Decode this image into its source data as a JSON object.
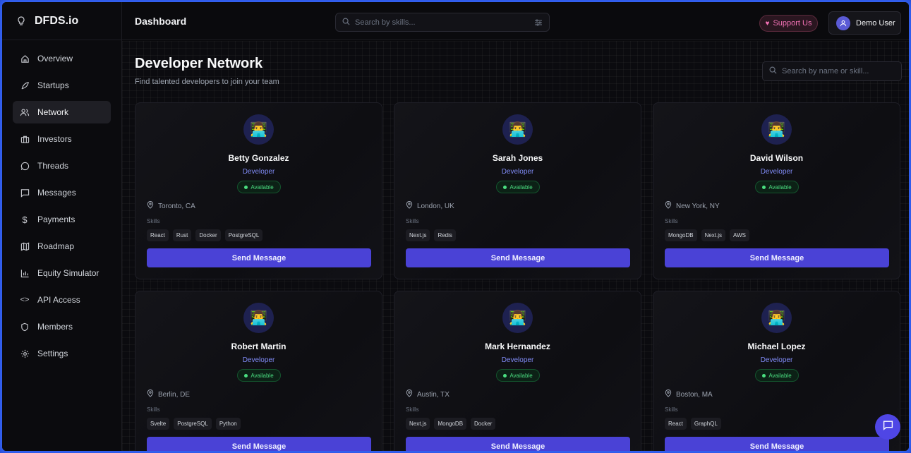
{
  "brand": {
    "name": "DFDS.io"
  },
  "sidebar": {
    "items": [
      {
        "label": "Overview",
        "icon": "home-icon"
      },
      {
        "label": "Startups",
        "icon": "rocket-icon"
      },
      {
        "label": "Network",
        "icon": "users-icon",
        "active": true
      },
      {
        "label": "Investors",
        "icon": "briefcase-icon"
      },
      {
        "label": "Threads",
        "icon": "chat-bubble-icon"
      },
      {
        "label": "Messages",
        "icon": "message-square-icon"
      },
      {
        "label": "Payments",
        "icon": "dollar-icon"
      },
      {
        "label": "Roadmap",
        "icon": "map-icon"
      },
      {
        "label": "Equity Simulator",
        "icon": "bar-chart-icon"
      },
      {
        "label": "API Access",
        "icon": "code-icon"
      },
      {
        "label": "Members",
        "icon": "shield-icon"
      },
      {
        "label": "Settings",
        "icon": "gear-icon"
      }
    ]
  },
  "topbar": {
    "title": "Dashboard",
    "search_placeholder": "Search by skills...",
    "support_label": "Support Us",
    "user_name": "Demo User"
  },
  "main": {
    "title": "Developer Network",
    "subtitle": "Find talented developers to join your team",
    "search_placeholder": "Search by name or skill...",
    "skills_label": "Skills",
    "send_label": "Send Message",
    "status_label": "Available",
    "developers": [
      {
        "name": "Betty Gonzalez",
        "role": "Developer",
        "location": "Toronto, CA",
        "skills": [
          "React",
          "Rust",
          "Docker",
          "PostgreSQL"
        ]
      },
      {
        "name": "Sarah Jones",
        "role": "Developer",
        "location": "London, UK",
        "skills": [
          "Next.js",
          "Redis"
        ]
      },
      {
        "name": "David Wilson",
        "role": "Developer",
        "location": "New York, NY",
        "skills": [
          "MongoDB",
          "Next.js",
          "AWS"
        ]
      },
      {
        "name": "Robert Martin",
        "role": "Developer",
        "location": "Berlin, DE",
        "skills": [
          "Svelte",
          "PostgreSQL",
          "Python"
        ]
      },
      {
        "name": "Mark Hernandez",
        "role": "Developer",
        "location": "Austin, TX",
        "skills": [
          "Next.js",
          "MongoDB",
          "Docker"
        ]
      },
      {
        "name": "Michael Lopez",
        "role": "Developer",
        "location": "Boston, MA",
        "skills": [
          "React",
          "GraphQL"
        ]
      }
    ]
  },
  "colors": {
    "accent": "#4a42d6",
    "available": "#4ade80",
    "support": "#f472b6",
    "role": "#818cf8"
  }
}
